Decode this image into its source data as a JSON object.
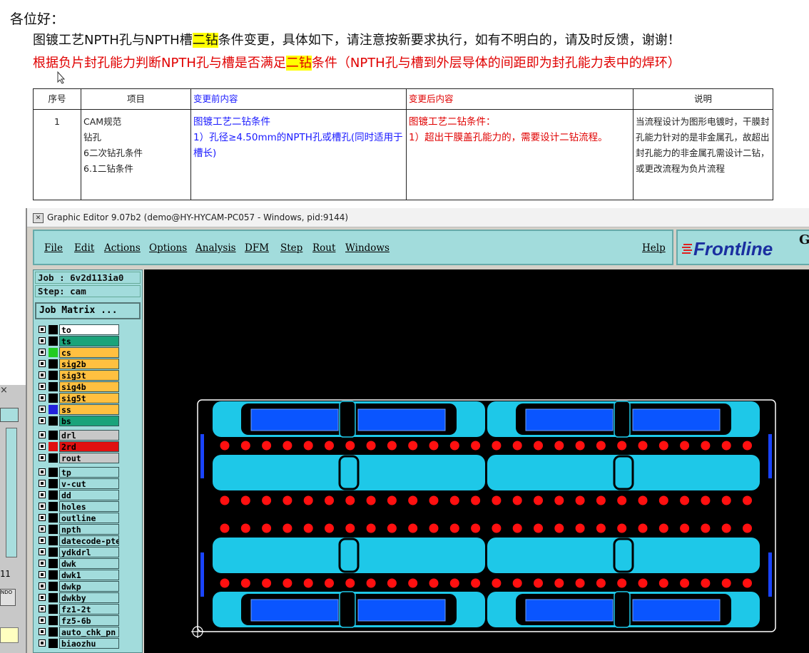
{
  "document": {
    "greeting": "各位好：",
    "line1_before": "图镀工艺NPTH孔与NPTH槽",
    "line1_highlight": "二钻",
    "line1_after": "条件变更，具体如下，请注意按新要求执行，如有不明白的，请及时反馈，谢谢！",
    "line2_before": "根据负片封孔能力判断NPTH孔与槽是否满足",
    "line2_highlight": "二钻",
    "line2_after": "条件（NPTH孔与槽到外层导体的间距即为封孔能力表中的焊环）",
    "table": {
      "headers": [
        "序号",
        "项目",
        "变更前内容",
        "变更后内容",
        "说明"
      ],
      "row": {
        "no": "1",
        "item_lines": [
          "CAM规范",
          "钻孔",
          "6二次钻孔条件",
          "6.1二钻条件"
        ],
        "before_title": "图镀工艺二钻条件",
        "before_body": "1）孔径≥4.50mm的NPTH孔或槽孔(同时适用于槽长)",
        "after_title": "图镀工艺二钻条件：",
        "after_body": "1）超出干膜盖孔能力的，需要设计二钻流程。",
        "note": "当流程设计为图形电镀时，干膜封孔能力针对的是非金属孔，故超出封孔能力的非金属孔需设计二钻，或更改流程为负片流程"
      }
    }
  },
  "editor": {
    "title": "Graphic Editor 9.07b2 (demo@HY-HYCAM-PC057 - Windows, pid:9144)",
    "menus": [
      "File",
      "Edit",
      "Actions",
      "Options",
      "Analysis",
      "DFM",
      "Step",
      "Rout",
      "Windows"
    ],
    "help": "Help",
    "logo": "Frontline",
    "logo_suffix": "G",
    "job_label": "Job : 6v2d113ia0",
    "step_label": "Step: cam",
    "job_matrix": "Job Matrix ...",
    "layers": [
      {
        "name": "to",
        "bg": "#ffffff",
        "swatch": "#000000"
      },
      {
        "name": "ts",
        "bg": "#1aa37a",
        "swatch": "#000000"
      },
      {
        "name": "cs",
        "bg": "#ffc040",
        "swatch": "#22cc22"
      },
      {
        "name": "sig2b",
        "bg": "#ffc040",
        "swatch": "#000000"
      },
      {
        "name": "sig3t",
        "bg": "#ffc040",
        "swatch": "#000000"
      },
      {
        "name": "sig4b",
        "bg": "#ffc040",
        "swatch": "#000000"
      },
      {
        "name": "sig5t",
        "bg": "#ffc040",
        "swatch": "#000000"
      },
      {
        "name": "ss",
        "bg": "#ffc040",
        "swatch": "#2222dd"
      },
      {
        "name": "bs",
        "bg": "#1aa37a",
        "swatch": "#000000"
      },
      {
        "name": "drl",
        "bg": "#c8c8c8",
        "swatch": "#000000"
      },
      {
        "name": "2rd",
        "bg": "#e01010",
        "swatch": "#e01010"
      },
      {
        "name": "rout",
        "bg": "#c8c8c8",
        "swatch": "#000000"
      },
      {
        "name": "tp",
        "bg": "#a2dcdc",
        "swatch": "#000000"
      },
      {
        "name": "v-cut",
        "bg": "#a2dcdc",
        "swatch": "#000000"
      },
      {
        "name": "dd",
        "bg": "#a2dcdc",
        "swatch": "#000000"
      },
      {
        "name": "holes",
        "bg": "#a2dcdc",
        "swatch": "#000000"
      },
      {
        "name": "outline",
        "bg": "#a2dcdc",
        "swatch": "#000000"
      },
      {
        "name": "npth",
        "bg": "#a2dcdc",
        "swatch": "#000000"
      },
      {
        "name": "datecode-pte",
        "bg": "#a2dcdc",
        "swatch": "#000000"
      },
      {
        "name": "ydkdrl",
        "bg": "#a2dcdc",
        "swatch": "#000000"
      },
      {
        "name": "dwk",
        "bg": "#a2dcdc",
        "swatch": "#000000"
      },
      {
        "name": "dwk1",
        "bg": "#a2dcdc",
        "swatch": "#000000"
      },
      {
        "name": "dwkp",
        "bg": "#a2dcdc",
        "swatch": "#000000"
      },
      {
        "name": "dwkby",
        "bg": "#a2dcdc",
        "swatch": "#000000"
      },
      {
        "name": "fz1-2t",
        "bg": "#a2dcdc",
        "swatch": "#000000"
      },
      {
        "name": "fz5-6b",
        "bg": "#a2dcdc",
        "swatch": "#000000"
      },
      {
        "name": "auto_chk_pn",
        "bg": "#a2dcdc",
        "swatch": "#000000"
      },
      {
        "name": "biaozhu",
        "bg": "#a2dcdc",
        "swatch": "#000000"
      }
    ],
    "colors": {
      "board": "#1ec8e8",
      "drill": "#ff1010",
      "dots": "#1a44ff",
      "background": "#000000"
    }
  },
  "left_window": {
    "close": "×",
    "text": "11",
    "button": "NDO"
  }
}
